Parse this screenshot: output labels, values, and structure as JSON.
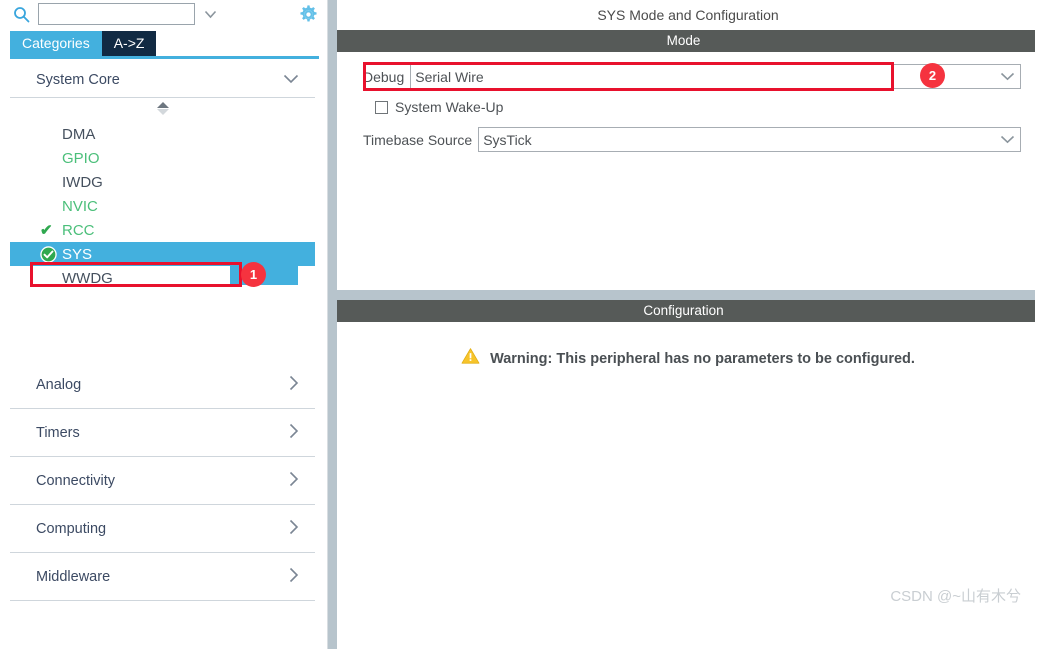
{
  "sidebar": {
    "search": {
      "icon": "search-icon",
      "value": "",
      "placeholder": "",
      "chevron": "chevron-down-icon"
    },
    "settings_icon": "gear-icon",
    "tabs": [
      {
        "label": "Categories",
        "active": true
      },
      {
        "label": "A->Z",
        "active": false
      }
    ],
    "expanded_category": {
      "label": "System Core",
      "chevron": "chevron-down-icon"
    },
    "peripherals": [
      {
        "label": "DMA",
        "state": "plain",
        "mark": ""
      },
      {
        "label": "GPIO",
        "state": "ok",
        "mark": ""
      },
      {
        "label": "IWDG",
        "state": "plain",
        "mark": ""
      },
      {
        "label": "NVIC",
        "state": "ok",
        "mark": ""
      },
      {
        "label": "RCC",
        "state": "ok",
        "mark": "check"
      },
      {
        "label": "SYS",
        "state": "selected",
        "mark": "check-circle"
      },
      {
        "label": "WWDG",
        "state": "plain",
        "mark": ""
      }
    ],
    "categories": [
      {
        "label": "Analog",
        "chevron": "chevron-right-icon"
      },
      {
        "label": "Timers",
        "chevron": "chevron-right-icon"
      },
      {
        "label": "Connectivity",
        "chevron": "chevron-right-icon"
      },
      {
        "label": "Computing",
        "chevron": "chevron-right-icon"
      },
      {
        "label": "Middleware",
        "chevron": "chevron-right-icon"
      }
    ]
  },
  "main": {
    "title": "SYS Mode and Configuration",
    "mode": {
      "header": "Mode",
      "debug_label": "Debug",
      "debug_value": "Serial Wire",
      "wakeup_label": "System Wake-Up",
      "wakeup_checked": false,
      "timebase_label": "Timebase Source",
      "timebase_value": "SysTick"
    },
    "configuration": {
      "header": "Configuration",
      "warning_icon": "warning-triangle-icon",
      "warning_text": "Warning: This peripheral has no parameters to be configured."
    },
    "watermark": "CSDN @~山有木兮"
  },
  "annotations": [
    {
      "badge": "1",
      "target": "sys-tree-item"
    },
    {
      "badge": "2",
      "target": "debug-combo"
    }
  ],
  "colors": {
    "accent_blue": "#43b0de",
    "tab_dark": "#112a43",
    "annotation_red": "#e8112d",
    "badge_red": "#f5333f",
    "section_gray": "#565a58",
    "divider": "#b7c4cc",
    "ok_green": "#4bbf7a",
    "warning_yellow": "#f7c42a"
  }
}
